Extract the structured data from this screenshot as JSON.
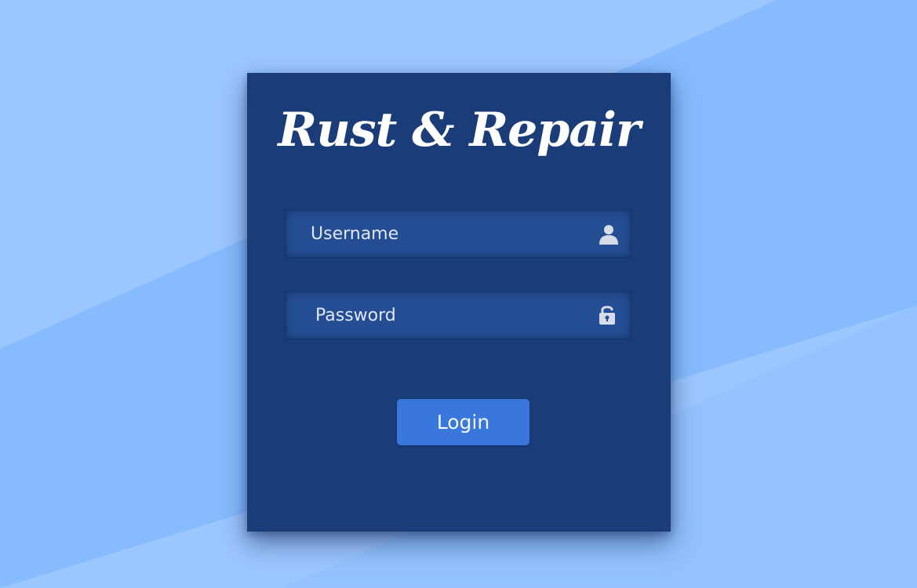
{
  "app": {
    "title": "Rust & Repair"
  },
  "form": {
    "username": {
      "placeholder": "Username",
      "value": "",
      "icon": "user-icon"
    },
    "password": {
      "placeholder": "Password",
      "value": "",
      "icon": "unlock-icon"
    },
    "login_label": "Login"
  },
  "colors": {
    "background": "#9cc6fe",
    "card": "#1a3c78",
    "field": "#244d93",
    "button": "#3a77dc",
    "text": "#ffffff"
  }
}
